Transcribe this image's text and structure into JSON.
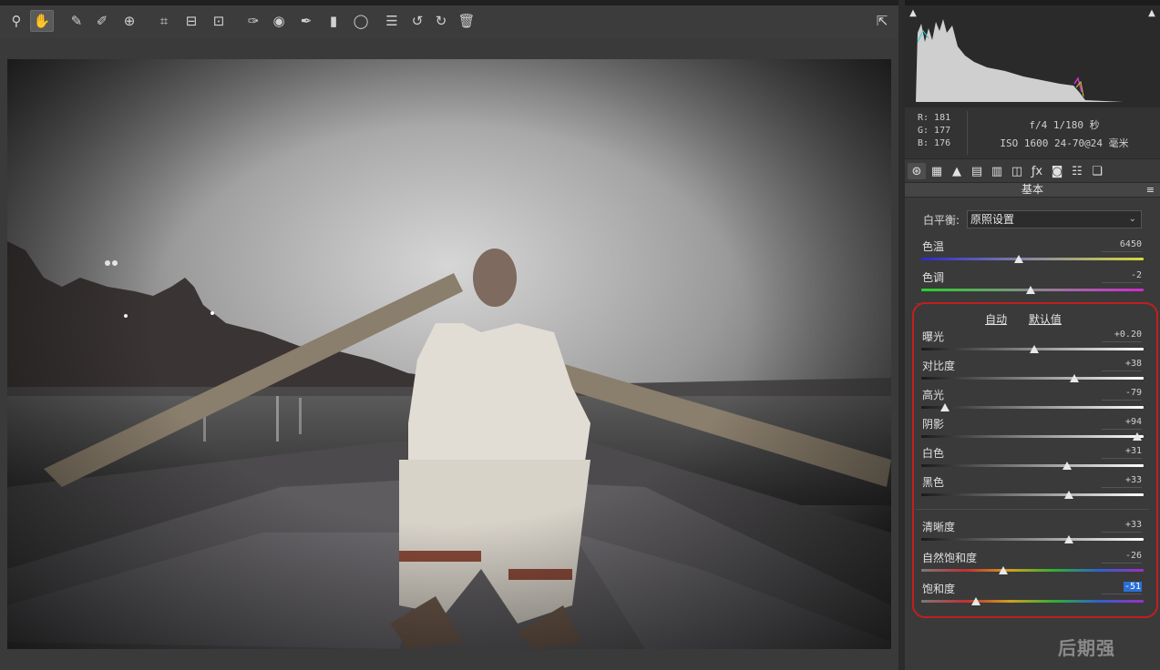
{
  "toolbar": {
    "tools": [
      {
        "name": "zoom-tool",
        "icon": "magnifier-icon",
        "glyph": "⚲"
      },
      {
        "name": "hand-tool",
        "icon": "hand-icon",
        "glyph": "✋"
      },
      {
        "name": "white-balance-tool",
        "icon": "eyedropper-icon",
        "glyph": "✎"
      },
      {
        "name": "color-sampler-tool",
        "icon": "eyedropper-plus-icon",
        "glyph": "✐"
      },
      {
        "name": "targeted-adjustment-tool",
        "icon": "target-icon",
        "glyph": "⊕"
      },
      {
        "name": "crop-tool",
        "icon": "crop-icon",
        "glyph": "⌗"
      },
      {
        "name": "straighten-tool",
        "icon": "ruler-icon",
        "glyph": "⊟"
      },
      {
        "name": "transform-tool",
        "icon": "transform-icon",
        "glyph": "⊡"
      },
      {
        "name": "spot-removal-tool",
        "icon": "brush-spot-icon",
        "glyph": "✑"
      },
      {
        "name": "red-eye-tool",
        "icon": "eye-icon",
        "glyph": "◉"
      },
      {
        "name": "adjustment-brush-tool",
        "icon": "brush-icon",
        "glyph": "✒"
      },
      {
        "name": "graduated-filter-tool",
        "icon": "gradient-icon",
        "glyph": "▮"
      },
      {
        "name": "radial-filter-tool",
        "icon": "ellipse-icon",
        "glyph": "◯"
      },
      {
        "name": "preferences-tool",
        "icon": "list-icon",
        "glyph": "☰"
      },
      {
        "name": "rotate-left-tool",
        "icon": "rotate-ccw-icon",
        "glyph": "↺"
      },
      {
        "name": "rotate-right-tool",
        "icon": "rotate-cw-icon",
        "glyph": "↻"
      },
      {
        "name": "trash-tool",
        "icon": "trash-icon",
        "glyph": "🗑"
      }
    ],
    "export_icon": "⇱"
  },
  "histogram": {
    "clip_left": "▲",
    "clip_right": "▲"
  },
  "meta": {
    "r": "R:  181",
    "g": "G:  177",
    "b": "B:  176",
    "exposure": "f/4   1/180 秒",
    "iso_lens": "ISO 1600   24-70@24 毫米"
  },
  "panel_tabs": [
    "aperture-icon",
    "grid-icon",
    "mountain-icon",
    "split-icon",
    "hsl-icon",
    "lens-icon",
    "fx-icon",
    "camera-icon",
    "sliders-icon",
    "presets-icon"
  ],
  "section": {
    "title": "基本",
    "menu": "≡"
  },
  "white_balance": {
    "label": "白平衡:",
    "value": "原照设置"
  },
  "sliders_top": [
    {
      "key": "temp",
      "label": "色温",
      "value": "6450",
      "pos": 0.44
    },
    {
      "key": "tint",
      "label": "色调",
      "value": "-2",
      "pos": 0.49
    }
  ],
  "links": {
    "auto": "自动",
    "default": "默认值"
  },
  "sliders_tone": [
    {
      "key": "exposure",
      "label": "曝光",
      "value": "+0.20",
      "pos": 0.51
    },
    {
      "key": "contrast",
      "label": "对比度",
      "value": "+38",
      "pos": 0.69
    },
    {
      "key": "highlights",
      "label": "高光",
      "value": "-79",
      "pos": 0.105
    },
    {
      "key": "shadows",
      "label": "阴影",
      "value": "+94",
      "pos": 0.97
    },
    {
      "key": "whites",
      "label": "白色",
      "value": "+31",
      "pos": 0.655
    },
    {
      "key": "blacks",
      "label": "黑色",
      "value": "+33",
      "pos": 0.665
    }
  ],
  "sliders_presence": [
    {
      "key": "clarity",
      "label": "清晰度",
      "value": "+33",
      "pos": 0.665
    },
    {
      "key": "vibrance",
      "label": "自然饱和度",
      "value": "-26",
      "pos": 0.37
    },
    {
      "key": "saturation",
      "label": "饱和度",
      "value": "-51",
      "pos": 0.245,
      "selected": true
    }
  ],
  "watermark": "后期强"
}
